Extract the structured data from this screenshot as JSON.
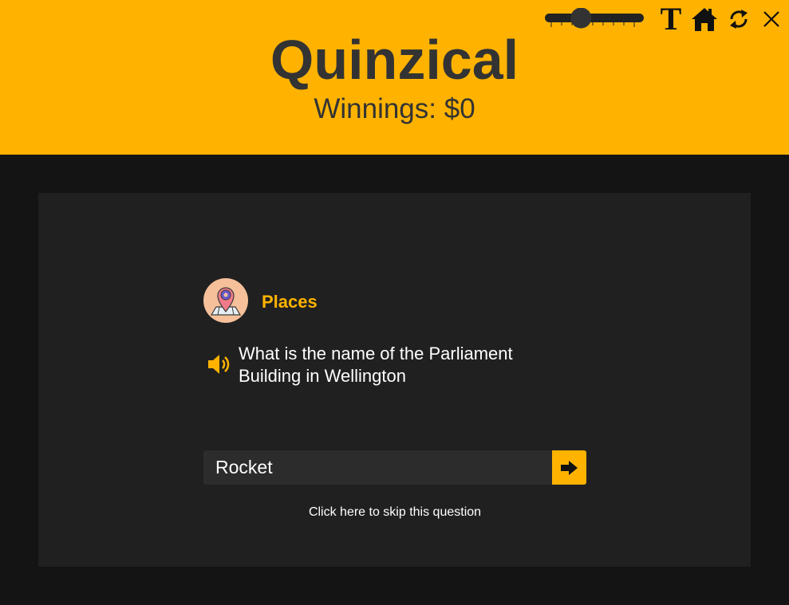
{
  "header": {
    "title": "Quinzical",
    "winnings": "Winnings: $0"
  },
  "toolbar": {
    "volume_slider": {
      "level_fraction": 0.33,
      "icon": "slider-track"
    },
    "text_size_label": "T",
    "home_icon": "home-icon",
    "refresh_icon": "refresh-icon",
    "close_icon": "close-icon"
  },
  "question": {
    "category": "Places",
    "category_icon": "map-pin-icon",
    "speaker_icon": "speaker-icon",
    "text": "What is the name of the Parliament Building in Wellington"
  },
  "answer": {
    "value": "Rocket",
    "submit_icon": "arrow-right-icon"
  },
  "skip": {
    "label": "Click here to skip this question"
  },
  "colors": {
    "accent": "#ffb300",
    "header_text": "#333333",
    "background": "#141414",
    "card": "#202020",
    "input": "#2c2c2c"
  }
}
